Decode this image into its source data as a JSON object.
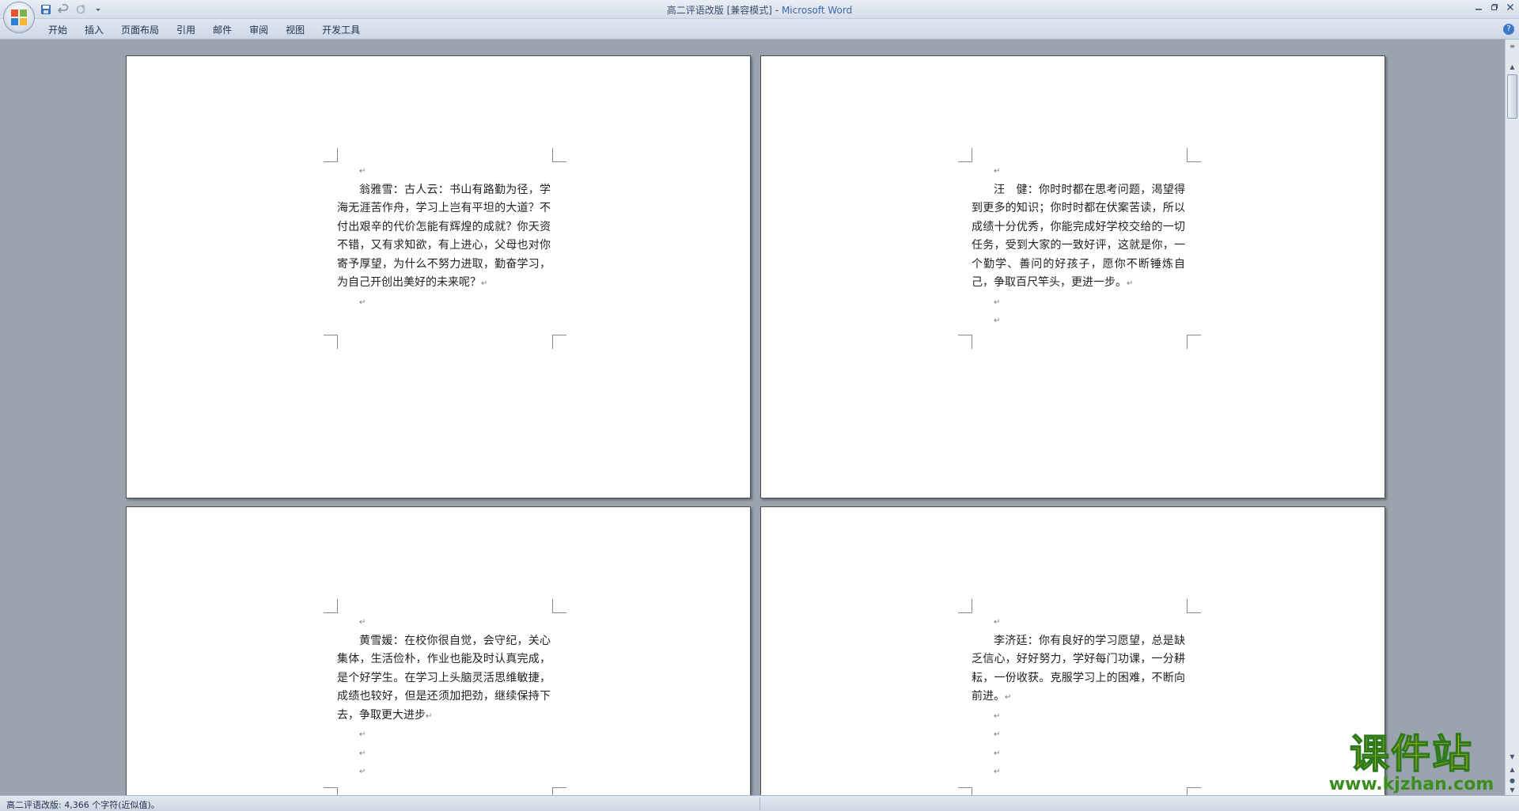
{
  "window": {
    "title": "高二评语改版 [兼容模式]",
    "title_separator": " - ",
    "app_name": "Microsoft Word",
    "controls": [
      "minimize-icon",
      "restore-icon",
      "close-icon"
    ]
  },
  "quick_access": [
    "save-icon",
    "undo-icon",
    "redo-icon",
    "customize-icon"
  ],
  "ribbon": {
    "tabs": [
      "开始",
      "插入",
      "页面布局",
      "引用",
      "邮件",
      "审阅",
      "视图",
      "开发工具"
    ],
    "help_label": "?"
  },
  "pages": [
    {
      "paragraph": "翁雅雪：古人云：书山有路勤为径，学海无涯苦作舟，学习上岂有平坦的大道？不付出艰辛的代价怎能有辉煌的成就？你天资不错，又有求知欲，有上进心，父母也对你寄予厚望，为什么不努力进取，勤奋学习，为自己开创出美好的未来呢？",
      "mark": "↵"
    },
    {
      "paragraph": "汪　健：你时时都在思考问题，渴望得到更多的知识；你时时都在伏案苦读，所以成绩十分优秀，你能完成好学校交给的一切任务，受到大家的一致好评，这就是你，一个勤学、善问的好孩子，愿你不断锤炼自己，争取百尺竿头，更进一步。",
      "mark": "↵"
    },
    {
      "paragraph": "黄雪媛：在校你很自觉，会守纪，关心集体，生活俭朴，作业也能及时认真完成，是个好学生。在学习上头脑灵活思维敏捷，成绩也较好，但是还须加把劲，继续保持下去，争取更大进步",
      "mark": "↵"
    },
    {
      "paragraph": "李济廷：你有良好的学习愿望，总是缺乏信心，好好努力，学好每门功课，一分耕耘，一份收获。克服学习上的困难，不断向前进。",
      "mark": "↵"
    }
  ],
  "status_bar": {
    "text": "高二评语改版: 4,366 个字符(近似值)。"
  },
  "watermark": {
    "logo": "课件站",
    "url": "www.kjzhan.com"
  }
}
